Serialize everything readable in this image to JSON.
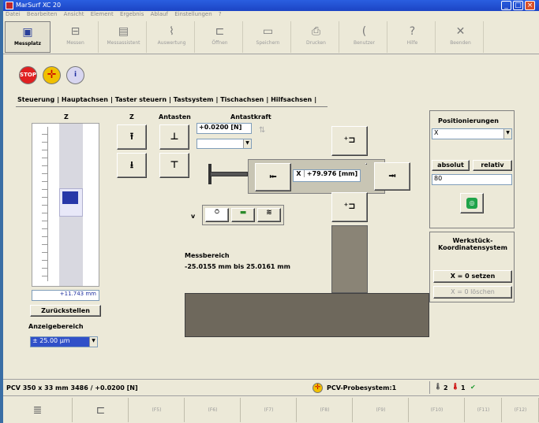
{
  "window": {
    "title": "MarSurf XC 20"
  },
  "menu": [
    "Datei",
    "Bearbeiten",
    "Ansicht",
    "Element",
    "Ergebnis",
    "Ablauf",
    "Einstellungen",
    "?"
  ],
  "toolbar": [
    {
      "label": "Messplatz",
      "icon": "workstation-icon",
      "active": true
    },
    {
      "label": "Messen",
      "icon": "measure-icon"
    },
    {
      "label": "Messassistent",
      "icon": "assistant-icon"
    },
    {
      "label": "Auswertung",
      "icon": "evaluation-icon"
    },
    {
      "label": "Öffnen",
      "icon": "open-icon"
    },
    {
      "label": "Speichern",
      "icon": "save-icon"
    },
    {
      "label": "Drucken",
      "icon": "print-icon"
    },
    {
      "label": "Benutzer",
      "icon": "user-icon"
    },
    {
      "label": "Hilfe",
      "icon": "help-icon"
    },
    {
      "label": "Beenden",
      "icon": "exit-icon"
    }
  ],
  "tabs": [
    "Steuerung",
    "Hauptachsen",
    "Taster steuern",
    "Tastsystem",
    "Tischachsen",
    "Hilfsachsen"
  ],
  "left": {
    "axis_label": "Z",
    "readout": "+11.743 mm",
    "reset_label": "Zurückstellen",
    "range_label": "Anzeigebereich",
    "range_value": "± 25.00 µm"
  },
  "center": {
    "z_label": "Z",
    "antasten_label": "Antasten",
    "force_label": "Antastkraft",
    "force_value": "+0.0200 [N]",
    "x_axis": "X",
    "x_value": "+79.976 [mm]",
    "v_label": "v",
    "range_title": "Messbereich",
    "range_value": "-25.0155 mm bis 25.0161 mm"
  },
  "right": {
    "pos_title": "Positionierungen",
    "pos_axis": "X",
    "absolut": "absolut",
    "relativ": "relativ",
    "pos_value": "80",
    "wks_title": "Werkstück-\nKoordinatensystem",
    "set_zero": "X = 0 setzen",
    "clear_zero": "X = 0 löschen"
  },
  "status": {
    "probe": "PCV 350 x 33 mm 3486 / +0.0200 [N]",
    "system": "PCV-Probesystem:1",
    "t1": "2",
    "t2": "1"
  },
  "fkeys": [
    "(F5)",
    "(F6)",
    "(F7)",
    "(F8)",
    "(F9)",
    "(F10)",
    "(F11)",
    "(F12)"
  ]
}
